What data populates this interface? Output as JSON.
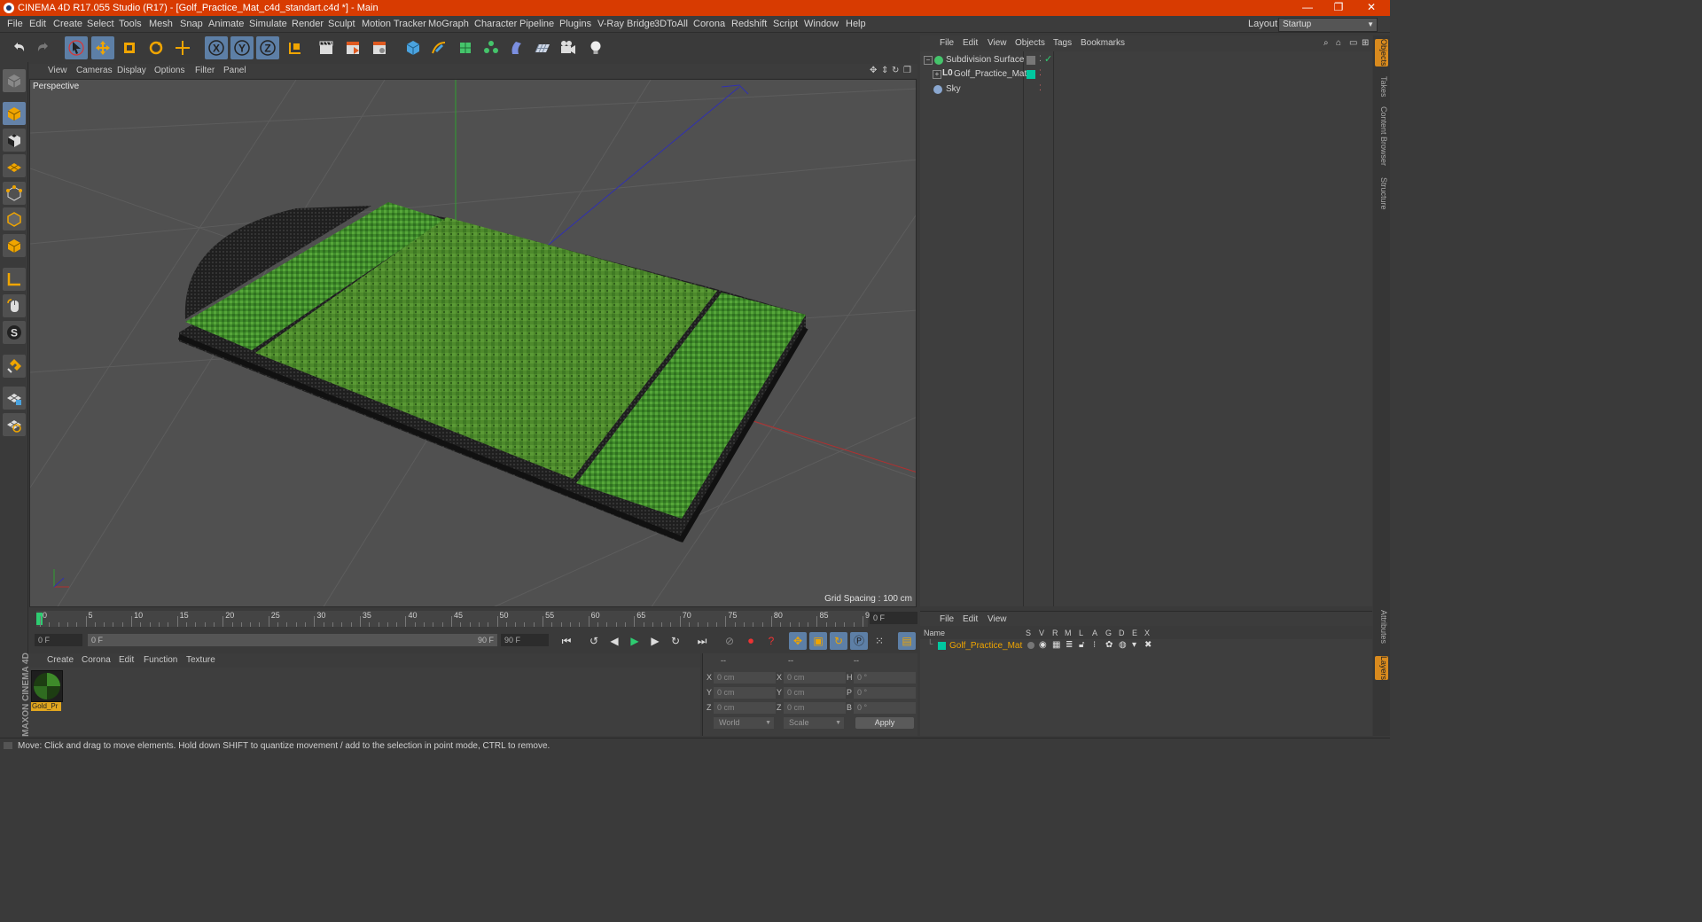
{
  "window": {
    "title": "CINEMA 4D R17.055 Studio (R17) - [Golf_Practice_Mat_c4d_standart.c4d *] - Main",
    "controls": [
      "—",
      "❐",
      "✕"
    ]
  },
  "menu": [
    "File",
    "Edit",
    "Create",
    "Select",
    "Tools",
    "Mesh",
    "Snap",
    "Animate",
    "Simulate",
    "Render",
    "Sculpt",
    "Motion Tracker",
    "MoGraph",
    "Character",
    "Pipeline",
    "Plugins",
    "V-Ray Bridge",
    "3DToAll",
    "Corona",
    "Redshift",
    "Script",
    "Window",
    "Help"
  ],
  "layout": {
    "label": "Layout:",
    "value": "Startup"
  },
  "viewport": {
    "menu": [
      "View",
      "Cameras",
      "Display",
      "Options",
      "Filter",
      "Panel"
    ],
    "label": "Perspective",
    "grid_spacing": "Grid Spacing : 100 cm"
  },
  "timeline": {
    "ticks": [
      "0",
      "5",
      "10",
      "15",
      "20",
      "25",
      "30",
      "35",
      "40",
      "45",
      "50",
      "55",
      "60",
      "65",
      "70",
      "75",
      "80",
      "85",
      "90"
    ],
    "current": "0 F",
    "start": "0 F",
    "range_start": "0 F",
    "range_end": "90 F",
    "end": "90 F"
  },
  "materials": {
    "menu": [
      "Create",
      "Corona",
      "Edit",
      "Function",
      "Texture"
    ],
    "items": [
      {
        "name": "Gold_Pr"
      }
    ]
  },
  "coords": {
    "headers": [
      "--",
      "--",
      "--"
    ],
    "rows": [
      {
        "a": "X",
        "av": "0 cm",
        "b": "X",
        "bv": "0 cm",
        "c": "H",
        "cv": "0 °"
      },
      {
        "a": "Y",
        "av": "0 cm",
        "b": "Y",
        "bv": "0 cm",
        "c": "P",
        "cv": "0 °"
      },
      {
        "a": "Z",
        "av": "0 cm",
        "b": "Z",
        "bv": "0 cm",
        "c": "B",
        "cv": "0 °"
      }
    ],
    "mode": "World",
    "type": "Scale",
    "apply": "Apply"
  },
  "objects": {
    "menu": [
      "File",
      "Edit",
      "View",
      "Objects",
      "Tags",
      "Bookmarks"
    ],
    "items": [
      {
        "name": "Subdivision Surface"
      },
      {
        "name": "Golf_Practice_Mat"
      },
      {
        "name": "Sky"
      }
    ]
  },
  "layers": {
    "menu": [
      "File",
      "Edit",
      "View"
    ],
    "columns": [
      "Name",
      "S",
      "V",
      "R",
      "M",
      "L",
      "A",
      "G",
      "D",
      "E",
      "X"
    ],
    "items": [
      {
        "name": "Golf_Practice_Mat"
      }
    ]
  },
  "side_tabs": [
    "Objects",
    "Takes",
    "Content Browser",
    "Structure",
    "Attributes",
    "Layers"
  ],
  "logo": "MAXON CINEMA 4D",
  "status": "Move: Click and drag to move elements. Hold down SHIFT to quantize movement / add to the selection in point mode, CTRL to remove.",
  "colors": {
    "accent": "#d83b01",
    "selected": "#5d7fa6",
    "grass": "#4e8a2c",
    "layer": "#00c8a0",
    "material_label": "#e1a61f"
  }
}
